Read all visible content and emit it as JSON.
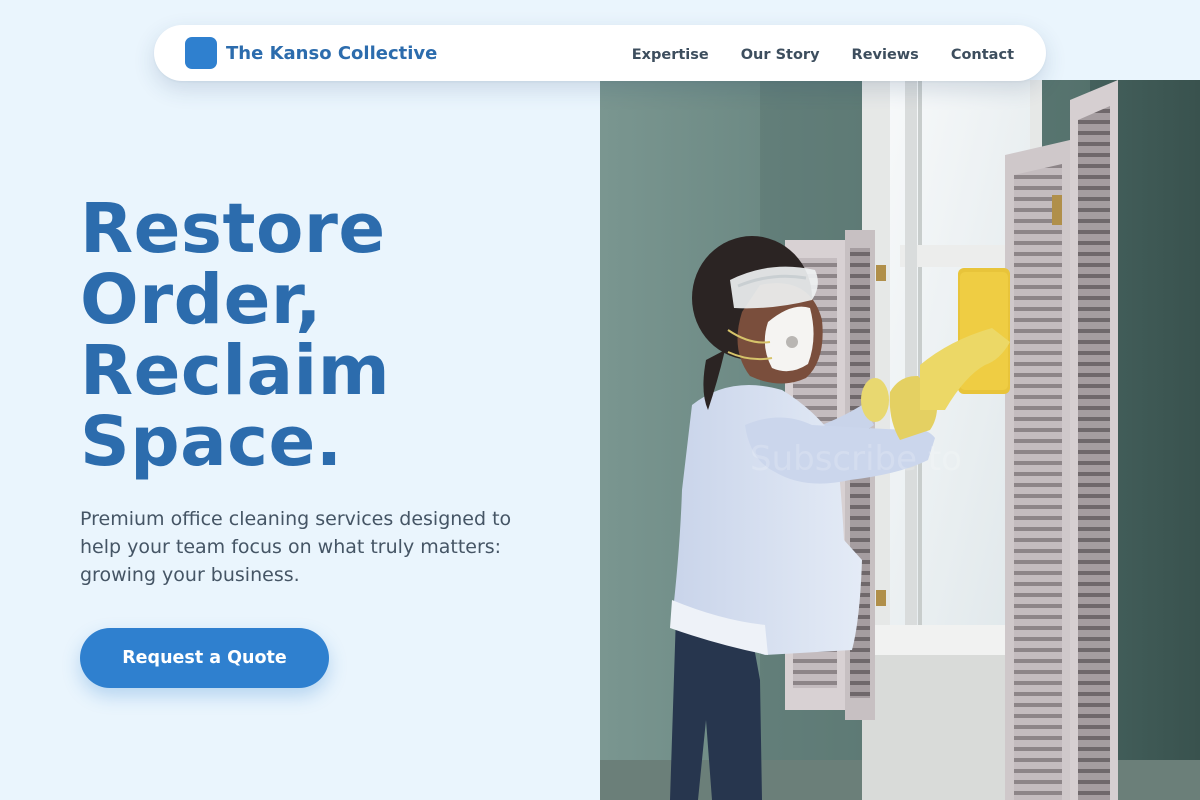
{
  "brand": {
    "name": "The Kanso Collective",
    "color": "#2f80cf"
  },
  "nav": {
    "items": [
      "Expertise",
      "Our Story",
      "Reviews",
      "Contact"
    ]
  },
  "hero": {
    "headline_lines": [
      "Restore",
      "Order,",
      "Reclaim",
      "Space."
    ],
    "subtext": "Premium office cleaning services designed to help your team focus on what truly matters: growing your business.",
    "cta_label": "Request a Quote",
    "photo_watermark": "Subscribe to"
  },
  "colors": {
    "page_bg": "#eaf5fd",
    "accent": "#2f80cf",
    "heading": "#2c6cad",
    "body_text": "#455565"
  }
}
